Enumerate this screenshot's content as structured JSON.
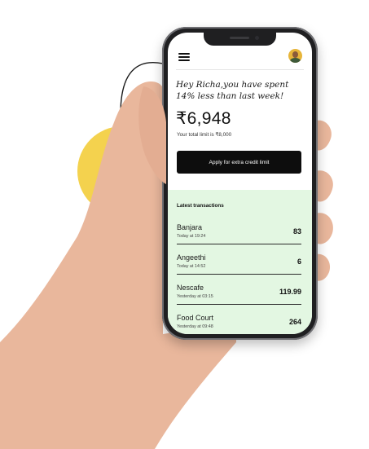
{
  "greeting": {
    "line1": "Hey Richa,you have spent",
    "line2": "14% less than last week!"
  },
  "spend": {
    "amount": "₹6,948",
    "limit_text": "Your total limit is  ₹8,000"
  },
  "actions": {
    "apply_label": "Apply for extra credit limit"
  },
  "transactions": {
    "title": "Latest transactions",
    "items": [
      {
        "name": "Banjara",
        "time": "Today at 19:24",
        "amount": "83"
      },
      {
        "name": "Angeethi",
        "time": "Today at 14:52",
        "amount": "6"
      },
      {
        "name": "Nescafe",
        "time": "Yesterday at 03:15",
        "amount": "119.99"
      },
      {
        "name": "Food Court",
        "time": "Yesterday at 09:48",
        "amount": "264"
      }
    ]
  },
  "colors": {
    "accent_green": "#e3f7e2",
    "button_dark": "#0d0d0d",
    "blob_yellow": "#f4d24e",
    "skin": "#e9b79c"
  },
  "icons": {
    "menu": "hamburger-menu-icon",
    "avatar": "profile-avatar"
  }
}
